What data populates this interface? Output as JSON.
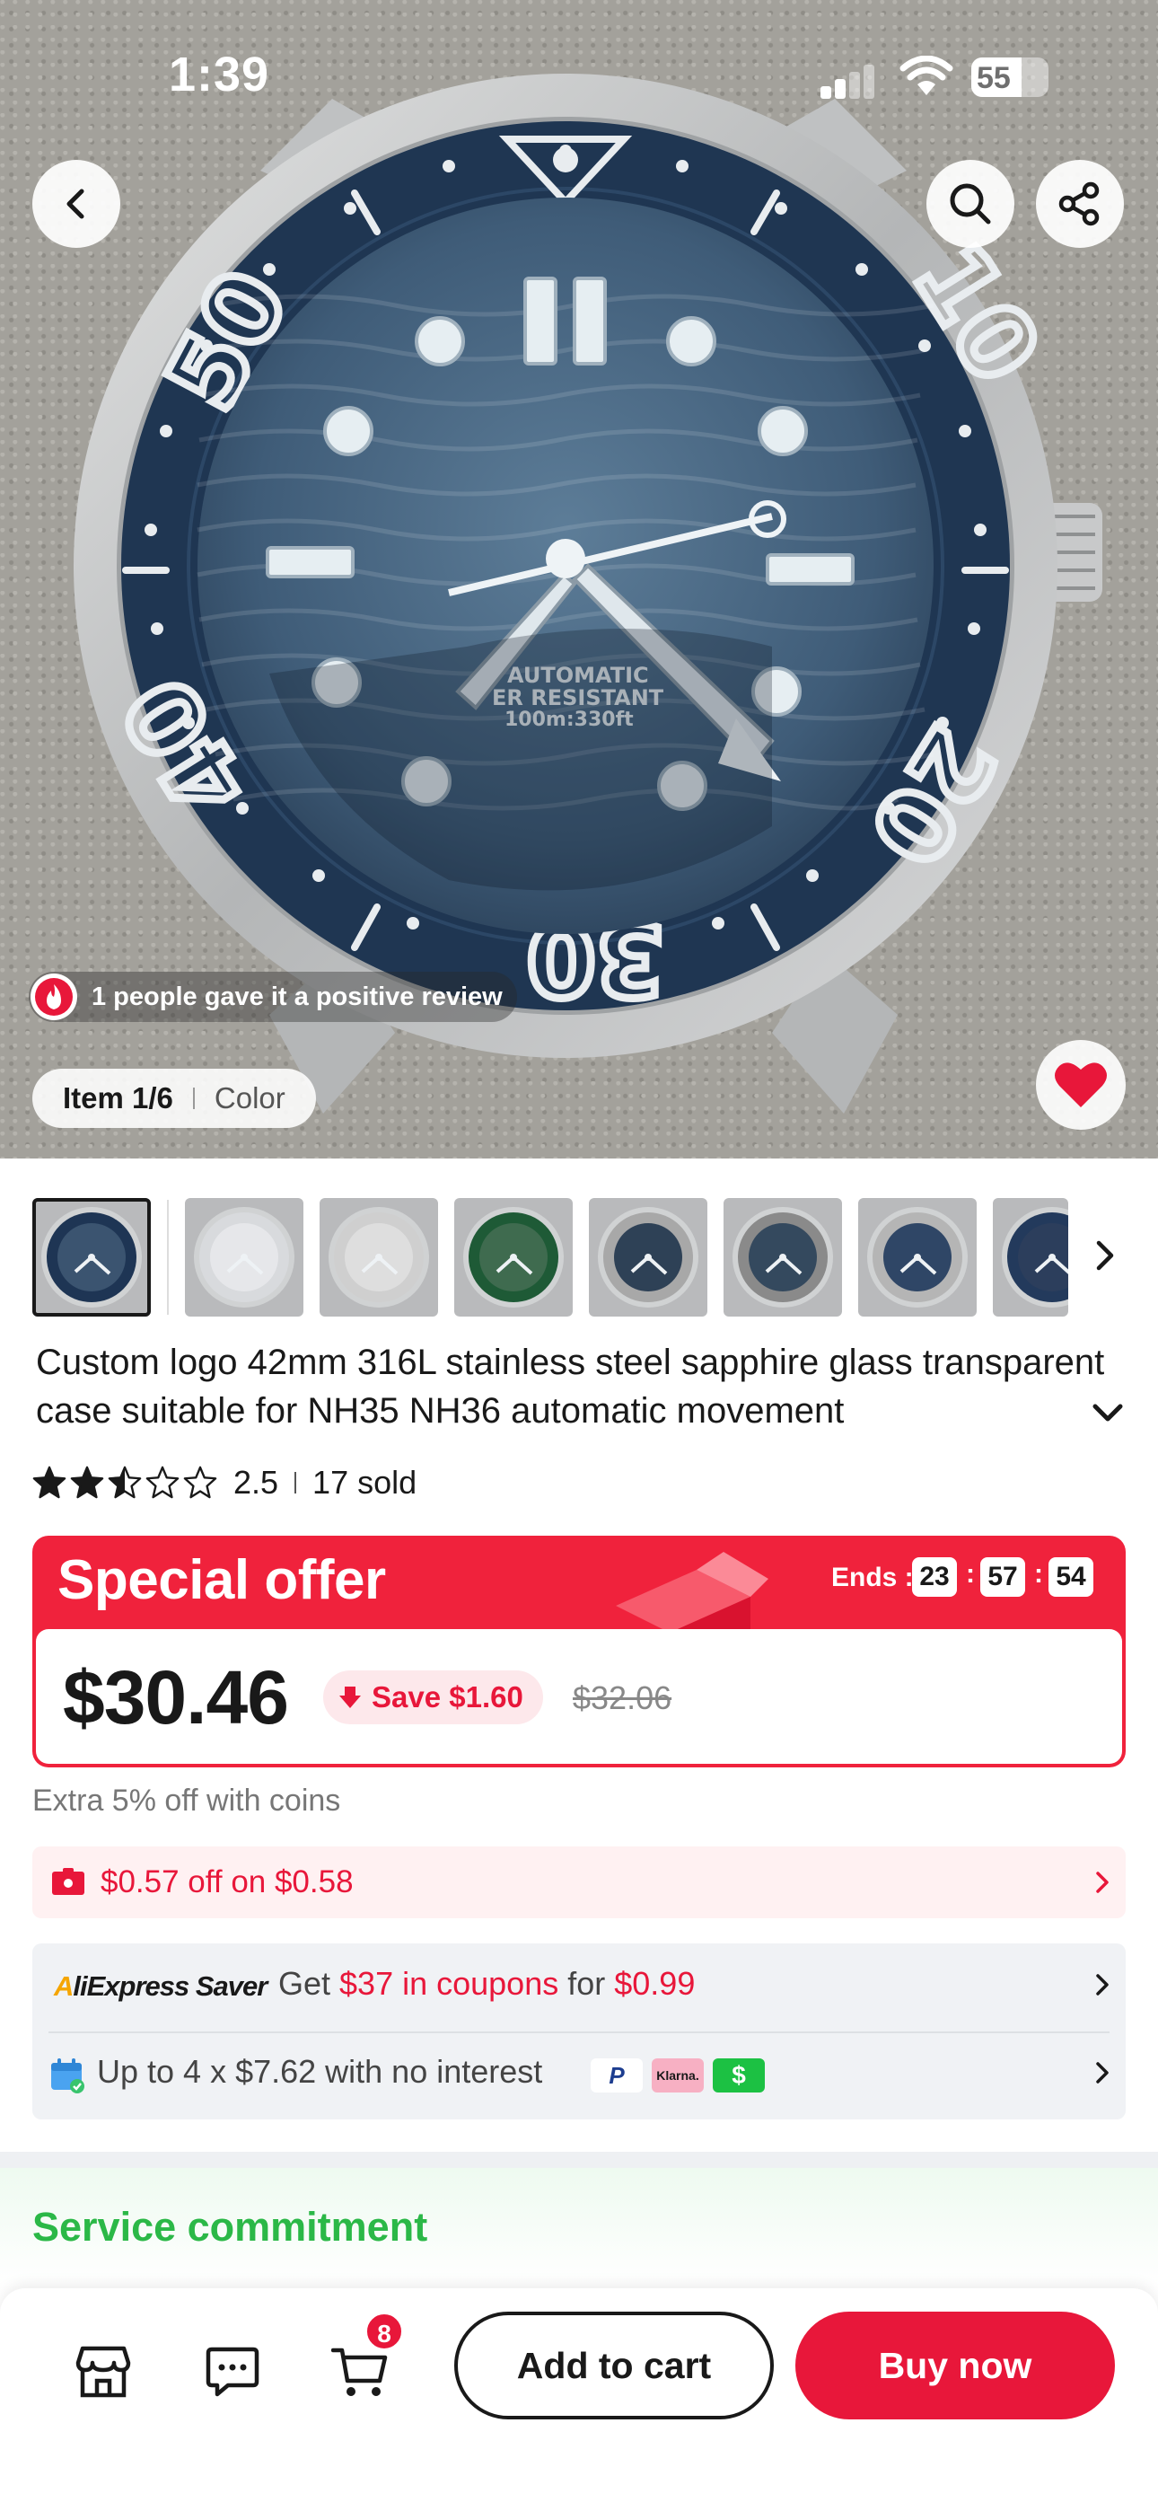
{
  "status_bar": {
    "time": "1:39",
    "battery": "55"
  },
  "product": {
    "review_note": "1 people gave it a positive review",
    "gallery": {
      "item_counter": "Item 1/6",
      "variant_label": "Color"
    },
    "title": "Custom logo 42mm 316L stainless steel sapphire glass transparent case suitable for NH35 NH36 automatic movement",
    "rating": "2.5",
    "rating_fraction": 0.5,
    "sold": "17 sold",
    "watch_text": {
      "line1": "AUTOMATIC",
      "line2": "ER RESISTANT",
      "line3": "100m:330ft",
      "bezel": [
        "50",
        "10",
        "20",
        "30",
        "40"
      ]
    },
    "thumbnails": [
      {
        "name": "thumb-blue-dial",
        "dial": "#3b5470",
        "bezel": "#1e3554"
      },
      {
        "name": "thumb-white-dial",
        "dial": "#e6e7ea",
        "bezel": "#d8dadd"
      },
      {
        "name": "thumb-white-dial-2",
        "dial": "#dedede",
        "bezel": "#cfcfcf"
      },
      {
        "name": "thumb-green-dial",
        "dial": "#3f6b4f",
        "bezel": "#1e5a36"
      },
      {
        "name": "thumb-navy-dial",
        "dial": "#2e4156",
        "bezel": "#a8a8a8"
      },
      {
        "name": "thumb-navy-dial-2",
        "dial": "#34495e",
        "bezel": "#8a8a8a"
      },
      {
        "name": "thumb-blue-dial-2",
        "dial": "#2f4666",
        "bezel": "#b5b5b5"
      },
      {
        "name": "thumb-blue-dial-3",
        "dial": "#2c3e5c",
        "bezel": "#233a5c"
      }
    ]
  },
  "offer": {
    "label": "Special offer",
    "ends_label": "Ends :",
    "timer": {
      "hours": "23",
      "minutes": "57",
      "seconds": "54"
    },
    "price": "$30.46",
    "save": "Save $1.60",
    "original_price": "$32.06"
  },
  "coins_text": "Extra 5% off with coins",
  "coupon": {
    "text": "$0.57 off on $0.58"
  },
  "saver": {
    "logo_a": "A",
    "logo_rest": "liExpress ",
    "logo_saver": "Saver",
    "text_get": "Get ",
    "text_amount": "$37 in coupons",
    "text_for": " for ",
    "text_price": "$0.99"
  },
  "installments": {
    "text": "Up to 4 x $7.62 with no interest",
    "logos": [
      "P",
      "Klarna.",
      "$"
    ]
  },
  "service": {
    "title": "Service commitment"
  },
  "bottom_bar": {
    "cart_count": "8",
    "add_to_cart": "Add to cart",
    "buy_now": "Buy now"
  },
  "colors": {
    "brand_red": "#e8173a",
    "service_green": "#2bb847"
  }
}
